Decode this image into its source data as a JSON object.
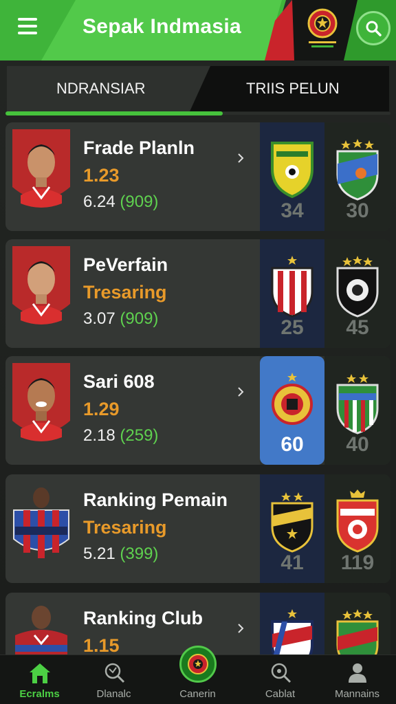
{
  "header": {
    "title": "Sepak Indmasia",
    "menu_icon": "menu-icon",
    "search_icon": "search-icon",
    "colors": {
      "green": "#3fb43a",
      "red": "#c9242b",
      "dark": "#141614"
    }
  },
  "tabs": [
    {
      "label": "NDRANSIAR",
      "active": true
    },
    {
      "label": "TRIIS PELUN",
      "active": false
    }
  ],
  "cards": [
    {
      "name": "Frade Planln",
      "value": "1.23",
      "stat": "6.24",
      "stat_paren": "(909)",
      "club_a_score": "34",
      "club_b_score": "30",
      "highlight": false,
      "chevron": true
    },
    {
      "name": "PeVerfain",
      "value": "Tresaring",
      "stat": "3.07",
      "stat_paren": "(909)",
      "club_a_score": "25",
      "club_b_score": "45",
      "highlight": false,
      "chevron": false
    },
    {
      "name": "Sari 608",
      "value": "1.29",
      "stat": "2.18",
      "stat_paren": "(259)",
      "club_a_score": "60",
      "club_b_score": "40",
      "highlight": true,
      "chevron": true
    },
    {
      "name": "Ranking Pemain",
      "value": "Tresaring",
      "stat": "5.21",
      "stat_paren": "(399)",
      "club_a_score": "41",
      "club_b_score": "119",
      "highlight": false,
      "chevron": false
    },
    {
      "name": "Ranking Club",
      "value": "1.15",
      "stat": "",
      "stat_paren": "",
      "club_a_score": "",
      "club_b_score": "",
      "highlight": false,
      "chevron": true
    }
  ],
  "nav": {
    "items": [
      {
        "label": "Ecralms",
        "icon": "home-icon",
        "active": true
      },
      {
        "label": "Dlanalc",
        "icon": "stats-icon",
        "active": false
      },
      {
        "label": "Canerin",
        "icon": "crest-icon",
        "active": false
      },
      {
        "label": "Cablat",
        "icon": "search-icon",
        "active": false
      },
      {
        "label": "Mannains",
        "icon": "user-icon",
        "active": false
      }
    ]
  }
}
